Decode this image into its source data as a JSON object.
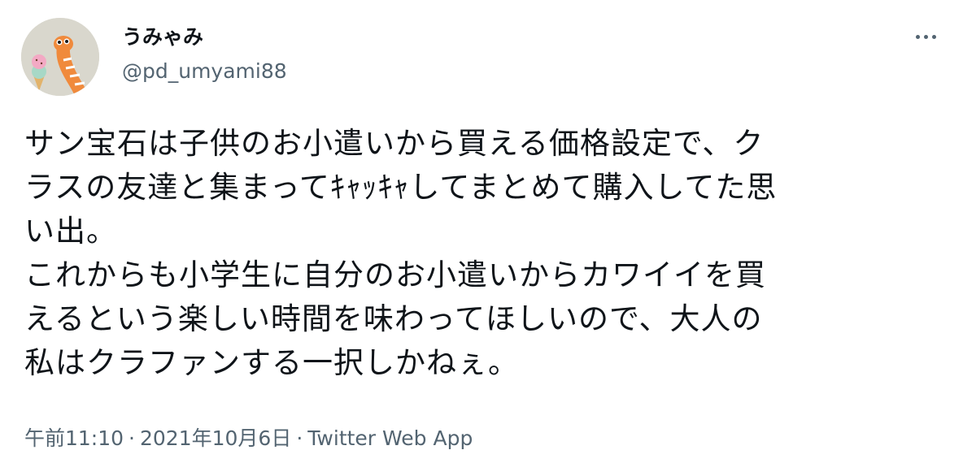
{
  "author": {
    "display_name": "うみゃみ",
    "handle": "@pd_umyami88",
    "avatar_icon": "avatar-eel-icecream-icon"
  },
  "menu": {
    "icon": "more-options-icon"
  },
  "tweet": {
    "lines": [
      "サン宝石は子供のお小遣いから買える価格設定で、ク",
      "ラスの友達と集まってｷｬｯｷｬしてまとめて購入してた思",
      "い出。",
      "これからも小学生に自分のお小遣いからカワイイを買",
      "えるという楽しい時間を味わってほしいので、大人の",
      "私はクラファンする一択しかねぇ。"
    ]
  },
  "meta": {
    "time": "午前11:10",
    "separator1": "·",
    "date": "2021年10月6日",
    "separator2": "·",
    "source": "Twitter Web App"
  },
  "colors": {
    "text_primary": "#0f1419",
    "text_secondary": "#536471",
    "background": "#ffffff"
  }
}
